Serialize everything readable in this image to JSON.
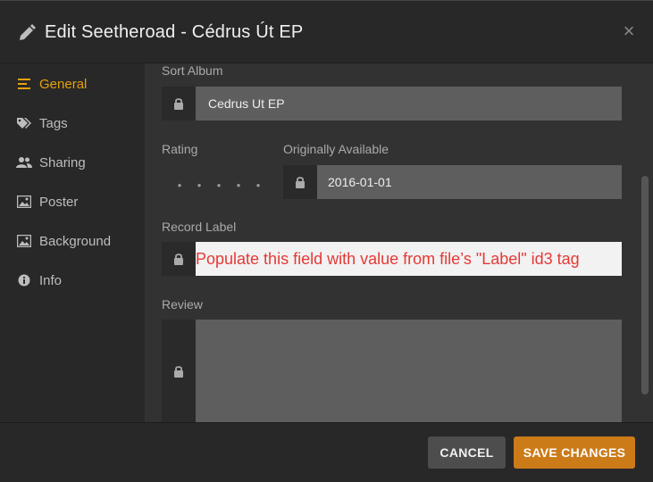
{
  "header": {
    "title": "Edit Seetheroad - Cédrus Út EP",
    "close_glyph": "×"
  },
  "sidebar": {
    "items": [
      {
        "label": "General",
        "icon": "list-icon",
        "active": true
      },
      {
        "label": "Tags",
        "icon": "tags-icon"
      },
      {
        "label": "Sharing",
        "icon": "users-icon"
      },
      {
        "label": "Poster",
        "icon": "image-icon"
      },
      {
        "label": "Background",
        "icon": "image-icon"
      },
      {
        "label": "Info",
        "icon": "info-icon"
      }
    ]
  },
  "form": {
    "sort_album_label": "Sort Album",
    "sort_album_value": "Cedrus Ut EP",
    "rating_label": "Rating",
    "rating_dots": [
      "•",
      "•",
      "•",
      "•",
      "•"
    ],
    "originally_available_label": "Originally Available",
    "originally_available_value": "2016-01-01",
    "record_label_label": "Record Label",
    "record_label_value": "Populate this field with value from file’s \"Label\" id3 tag",
    "review_label": "Review",
    "review_value": ""
  },
  "footer": {
    "cancel_label": "CANCEL",
    "save_label": "SAVE CHANGES"
  },
  "colors": {
    "accent": "#e5a00d",
    "save_button": "#cc7b19",
    "annotation_red": "#e53935"
  }
}
